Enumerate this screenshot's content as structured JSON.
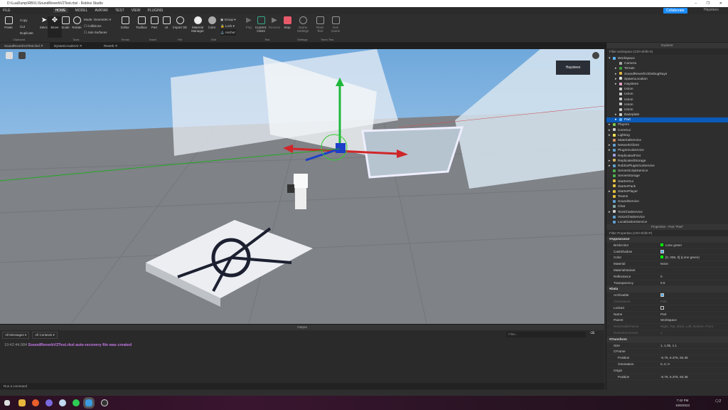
{
  "window": {
    "title": "D:\\LuaDump\\RBXL\\SoundReverbV2Test.rbxl - Roblox Studio",
    "minimize": "–",
    "maximize": "❐",
    "close": "✕"
  },
  "menu": [
    "FILE",
    "HOME",
    "MODEL",
    "AVATAR",
    "TEST",
    "VIEW",
    "PLUGINS"
  ],
  "topright": {
    "collaborate": "Collaborate",
    "user": "Haystees"
  },
  "ribbon": {
    "clipboard": {
      "paste": "Paste",
      "copy": "Copy",
      "cut": "Cut",
      "duplicate": "Duplicate",
      "label": "Clipboard"
    },
    "tools": {
      "items": [
        "Select",
        "Move",
        "Scale",
        "Rotate"
      ],
      "mode_label": "Mode:",
      "mode_value": "Geometric",
      "collisions": "Collisions",
      "join_surfaces": "Join Surfaces",
      "label": "Tools"
    },
    "terrain": {
      "items": [
        "Editor"
      ],
      "label": "Terrain"
    },
    "insert": {
      "items": [
        "Toolbox",
        "Part",
        "UI"
      ],
      "label": "Insert"
    },
    "file": {
      "items": [
        "Import 3D"
      ],
      "label": "File"
    },
    "edit": {
      "items": [
        "Material Manager",
        "Color"
      ],
      "group": "Group",
      "lock": "Lock",
      "anchor": "Anchor",
      "label": "Edit"
    },
    "test": {
      "items": [
        "Play",
        "Current: Client",
        "Resume",
        "Stop"
      ],
      "label": "Test"
    },
    "settings": {
      "items": [
        "Game Settings"
      ],
      "label": "Settings"
    },
    "teamtest": {
      "items": [
        "Team Test",
        "Exit Game"
      ],
      "label": "Team Test"
    }
  },
  "doc_tabs": [
    "SoundReverbV2Test.rbxl",
    "DynamicAudioV2",
    "Reverb"
  ],
  "viewport": {
    "player_label": "Haystees"
  },
  "output": {
    "title": "Output",
    "messages_filter": "All Messages",
    "contexts_filter": "All Contexts",
    "filter_placeholder": "Filter...",
    "log": [
      {
        "time": "19:42:44.984",
        "text": "SoundReverbV2Test.rbxl auto-recovery file was created",
        "color": "#c878e8"
      }
    ],
    "command_placeholder": "Run a command"
  },
  "explorer": {
    "title": "Explorer",
    "filter_placeholder": "Filter workspace (Ctrl+Shift+X)",
    "items": [
      {
        "label": "Workspace",
        "depth": 0,
        "exp": "▾",
        "color": "#5ab4ff"
      },
      {
        "label": "Camera",
        "depth": 1,
        "exp": "",
        "color": "#aaa"
      },
      {
        "label": "Terrain",
        "depth": 1,
        "exp": "▸",
        "color": "#3c9b3c"
      },
      {
        "label": "SoundReverbV2DebugRays",
        "depth": 1,
        "exp": "▸",
        "color": "#e0b040"
      },
      {
        "label": "SpawnLocation",
        "depth": 1,
        "exp": "▸",
        "color": "#ddd"
      },
      {
        "label": "Haystees",
        "depth": 1,
        "exp": "▸",
        "color": "#e6a0c8"
      },
      {
        "label": "Union",
        "depth": 1,
        "exp": "",
        "color": "#ccc"
      },
      {
        "label": "Union",
        "depth": 1,
        "exp": "",
        "color": "#ccc"
      },
      {
        "label": "Union",
        "depth": 1,
        "exp": "",
        "color": "#ccc"
      },
      {
        "label": "Union",
        "depth": 1,
        "exp": "",
        "color": "#ccc"
      },
      {
        "label": "Union",
        "depth": 1,
        "exp": "",
        "color": "#ccc"
      },
      {
        "label": "Baseplate",
        "depth": 1,
        "exp": "▸",
        "color": "#ccc"
      },
      {
        "label": "Part",
        "depth": 1,
        "exp": "▸",
        "color": "#5ab4ff",
        "selected": true
      },
      {
        "label": "Players",
        "depth": 0,
        "exp": "▸",
        "color": "#7ac74f"
      },
      {
        "label": "CoreGui",
        "depth": 0,
        "exp": "▸",
        "color": "#ccc"
      },
      {
        "label": "Lighting",
        "depth": 0,
        "exp": "▸",
        "color": "#f0e050"
      },
      {
        "label": "MaterialService",
        "depth": 0,
        "exp": "",
        "color": "#d09060"
      },
      {
        "label": "NetworkClient",
        "depth": 0,
        "exp": "▸",
        "color": "#60a0d0"
      },
      {
        "label": "PluginGuiService",
        "depth": 0,
        "exp": "▸",
        "color": "#60a0d0"
      },
      {
        "label": "ReplicatedFirst",
        "depth": 0,
        "exp": "",
        "color": "#a0a0e0"
      },
      {
        "label": "ReplicatedStorage",
        "depth": 0,
        "exp": "▸",
        "color": "#d0b060"
      },
      {
        "label": "RobloxPluginGuiService",
        "depth": 0,
        "exp": "▸",
        "color": "#60a0d0"
      },
      {
        "label": "ServerScriptService",
        "depth": 0,
        "exp": "",
        "color": "#50b050"
      },
      {
        "label": "ServerStorage",
        "depth": 0,
        "exp": "",
        "color": "#50b050"
      },
      {
        "label": "StarterGui",
        "depth": 0,
        "exp": "",
        "color": "#e0c040"
      },
      {
        "label": "StarterPack",
        "depth": 0,
        "exp": "",
        "color": "#e0c040"
      },
      {
        "label": "StarterPlayer",
        "depth": 0,
        "exp": "▸",
        "color": "#e0c040"
      },
      {
        "label": "Teams",
        "depth": 0,
        "exp": "",
        "color": "#e0c040"
      },
      {
        "label": "SoundService",
        "depth": 0,
        "exp": "",
        "color": "#60a0d0"
      },
      {
        "label": "Chat",
        "depth": 0,
        "exp": "",
        "color": "#8aa"
      },
      {
        "label": "TextChatService",
        "depth": 0,
        "exp": "▸",
        "color": "#ccc"
      },
      {
        "label": "VoiceChatService",
        "depth": 0,
        "exp": "",
        "color": "#60a0d0"
      },
      {
        "label": "LocalizationService",
        "depth": 0,
        "exp": "",
        "color": "#60a0d0"
      }
    ]
  },
  "properties": {
    "title": "Properties - Part \"Part\"",
    "filter_placeholder": "Filter Properties (Ctrl+Shift+P)",
    "rows": [
      {
        "section": "Appearance"
      },
      {
        "k": "BrickColor",
        "v": "Lime green",
        "swatch": "#00ff00"
      },
      {
        "k": "CastShadow",
        "v": "",
        "check": true
      },
      {
        "k": "Color",
        "v": "[0, 255, 0] (Lime green)",
        "swatch": "#00ff00"
      },
      {
        "k": "Material",
        "v": "Neon"
      },
      {
        "k": "MaterialVariant",
        "v": ""
      },
      {
        "k": "Reflectance",
        "v": "0"
      },
      {
        "k": "Transparency",
        "v": "0.5"
      },
      {
        "section": "Data"
      },
      {
        "k": "Archivable",
        "v": "",
        "check": true
      },
      {
        "k": "ClassName",
        "v": "Part",
        "dim": true
      },
      {
        "k": "Locked",
        "v": "",
        "check": false
      },
      {
        "k": "Name",
        "v": "Part"
      },
      {
        "k": "Parent",
        "v": "Workspace"
      },
      {
        "k": "ResizeableFaces",
        "v": "Right, Top, Back, Left, Bottom, Front",
        "dim": true
      },
      {
        "k": "ResizeIncrement",
        "v": "1",
        "dim": true
      },
      {
        "section": "Transform"
      },
      {
        "k": "Size",
        "v": "1, 1.05, 1.1"
      },
      {
        "k": "CFrame",
        "v": ""
      },
      {
        "k": "Position",
        "v": "-6.75, 6.375, 50.35",
        "indent": true
      },
      {
        "k": "Orientation",
        "v": "0, 0, 0",
        "indent": true
      },
      {
        "k": "Origin",
        "v": ""
      },
      {
        "k": "Position",
        "v": "-6.75, 6.375, 50.35",
        "indent": true
      }
    ]
  },
  "taskbar": {
    "time": "7:42 PM",
    "date": "10/6/2023",
    "notifications": "2",
    "apps": [
      "windows-start",
      "file-explorer",
      "firefox",
      "discord",
      "steam",
      "spotify",
      "roblox-studio",
      "obs"
    ]
  }
}
